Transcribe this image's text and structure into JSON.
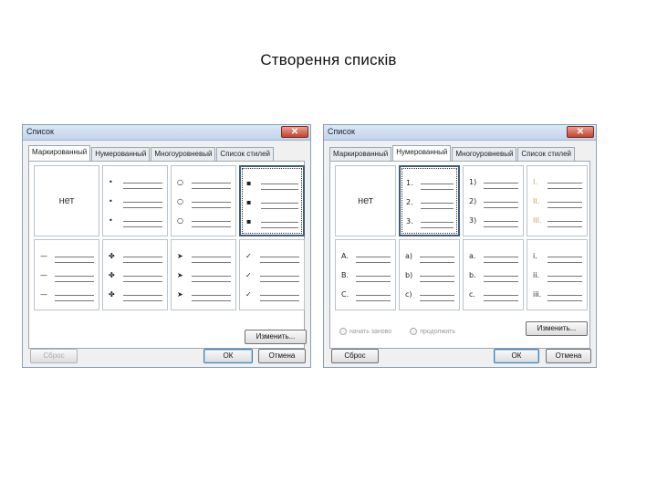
{
  "slide": {
    "title": "Створення списків"
  },
  "dialogs": [
    {
      "caption": "Список",
      "close_glyph": "✕",
      "tabs": [
        "Маркированный",
        "Нумерованный",
        "Многоуровневый",
        "Список стилей"
      ],
      "active_tab": 0,
      "none_label": "нет",
      "cells": [
        {
          "markers": []
        },
        {
          "markers": [
            "•",
            "•",
            "•"
          ]
        },
        {
          "markers": [
            "○",
            "○",
            "○"
          ]
        },
        {
          "markers": [
            "▪",
            "▪",
            "▪"
          ]
        },
        {
          "markers": [
            "—",
            "—",
            "—"
          ]
        },
        {
          "markers": [
            "✤",
            "✤",
            "✤"
          ]
        },
        {
          "markers": [
            "➤",
            "➤",
            "➤"
          ]
        },
        {
          "markers": [
            "✓",
            "✓",
            "✓"
          ]
        }
      ],
      "selected_cell": 3,
      "change_button": "Изменить...",
      "reset_button": "Сброс",
      "ok_button": "ОК",
      "cancel_button": "Отмена"
    },
    {
      "caption": "Список",
      "close_glyph": "✕",
      "tabs": [
        "Маркированный",
        "Нумерованный",
        "Многоуровневый",
        "Список стилей"
      ],
      "active_tab": 1,
      "none_label": "нет",
      "cells": [
        {
          "markers": []
        },
        {
          "markers": [
            "1.",
            "2.",
            "3."
          ]
        },
        {
          "markers": [
            "1)",
            "2)",
            "3)"
          ]
        },
        {
          "markers": [
            "I.",
            "II.",
            "III."
          ]
        },
        {
          "markers": [
            "A.",
            "B.",
            "C."
          ]
        },
        {
          "markers": [
            "a)",
            "b)",
            "c)"
          ]
        },
        {
          "markers": [
            "a.",
            "b.",
            "c."
          ]
        },
        {
          "markers": [
            "i.",
            "ii.",
            "iii."
          ]
        }
      ],
      "selected_cell": 1,
      "change_button": "Изменить...",
      "option_restart": "начать заново",
      "option_continue": "продолжить",
      "reset_button": "Сброс",
      "ok_button": "ОК",
      "cancel_button": "Отмена"
    }
  ]
}
